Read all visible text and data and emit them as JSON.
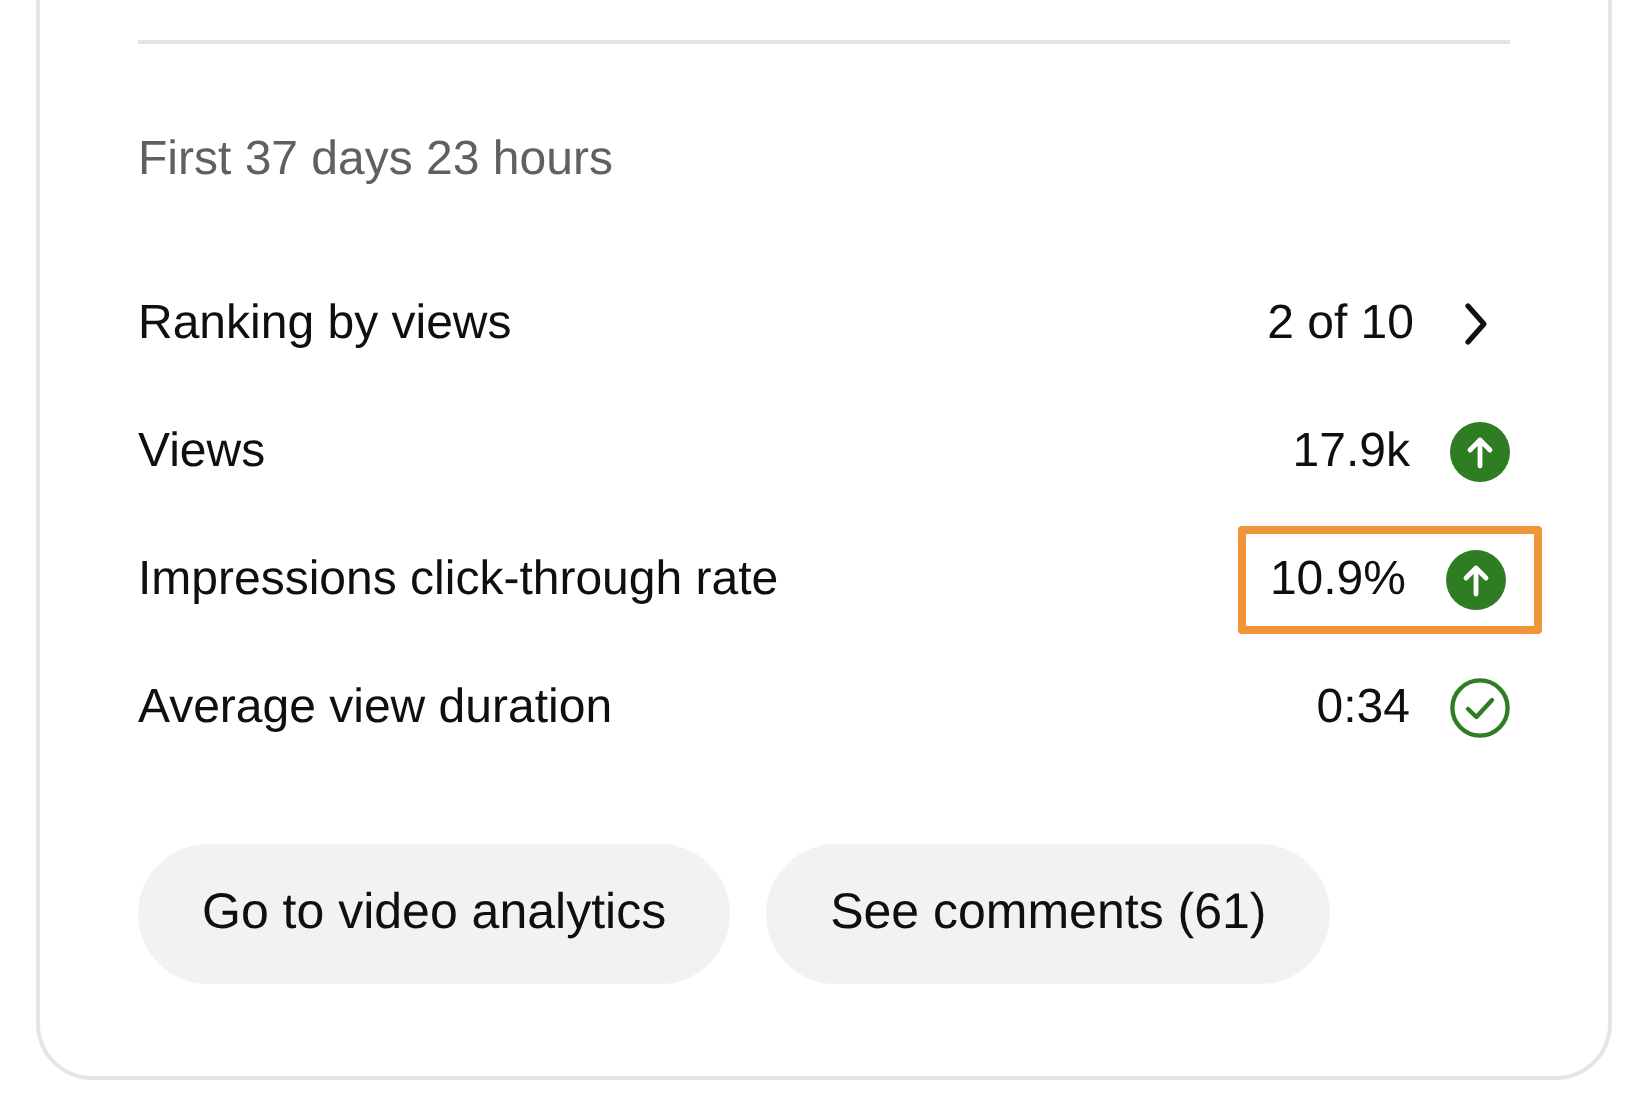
{
  "period": "First 37 days 23 hours",
  "metrics": [
    {
      "label": "Ranking by views",
      "value": "2 of 10",
      "kind": "link",
      "highlighted": false
    },
    {
      "label": "Views",
      "value": "17.9k",
      "kind": "up",
      "highlighted": false
    },
    {
      "label": "Impressions click-through rate",
      "value": "10.9%",
      "kind": "up",
      "highlighted": true
    },
    {
      "label": "Average view duration",
      "value": "0:34",
      "kind": "check",
      "highlighted": false
    }
  ],
  "buttons": [
    "Go to video analytics",
    "See comments (61)"
  ]
}
